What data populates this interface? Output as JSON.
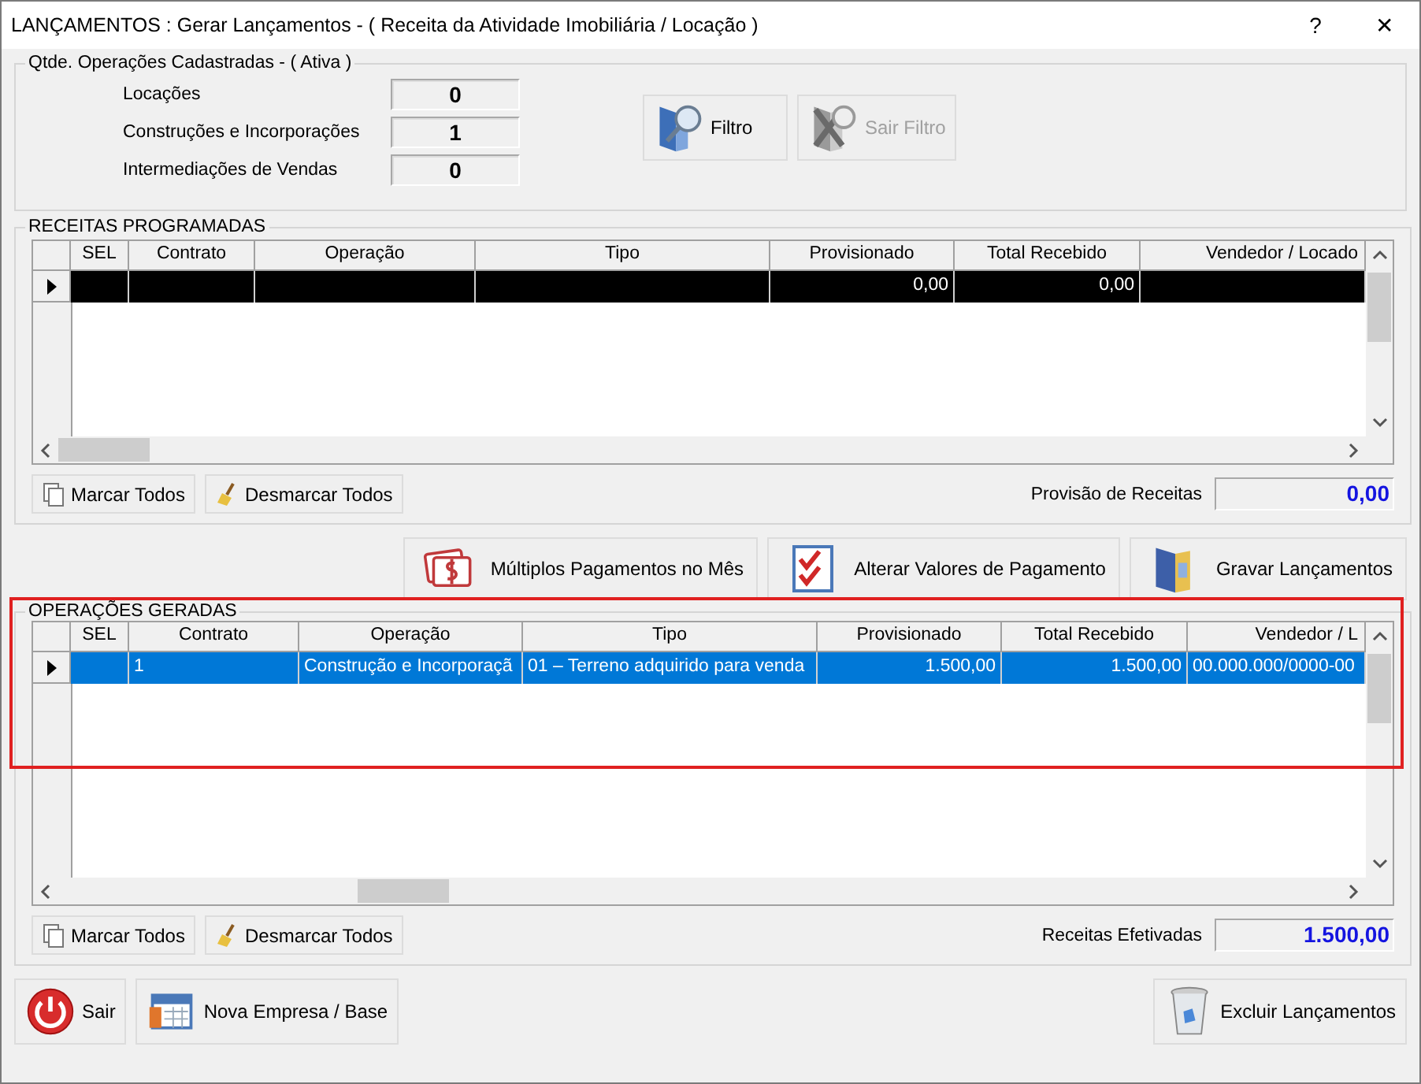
{
  "window": {
    "title": "LANÇAMENTOS : Gerar Lançamentos - ( Receita da Atividade Imobiliária / Locação )",
    "controls": [
      "?",
      "✕"
    ]
  },
  "counts": {
    "title": "Qtde. Operações Cadastradas - ( Ativa )",
    "items": [
      {
        "label": "Locações",
        "value": "0"
      },
      {
        "label": "Construções e Incorporações",
        "value": "1"
      },
      {
        "label": "Intermediações de Vendas",
        "value": "0"
      }
    ]
  },
  "filter_buttons": [
    {
      "label": "Filtro",
      "kind": "filter",
      "disabled": false
    },
    {
      "label": "Sair Filtro",
      "kind": "clear",
      "disabled": true
    }
  ],
  "receitas": {
    "title": "RECEITAS PROGRAMADAS",
    "focused": false,
    "columns": [
      "SEL",
      "Contrato",
      "Operação",
      "Tipo",
      "Provisionado",
      "Total Recebido",
      "Vendedor / Locado"
    ],
    "rows": [
      {
        "selected": true,
        "cells": [
          null,
          null,
          null,
          null,
          "0,00",
          "0,00",
          null
        ]
      }
    ],
    "buttons": [
      {
        "label": "Marcar Todos",
        "kind": "check"
      },
      {
        "label": "Desmarcar Todos",
        "kind": "broom"
      }
    ],
    "total": {
      "label": "Provisão de Receitas",
      "value": "0,00"
    }
  },
  "actions": [
    {
      "label": "Múltiplos Pagamentos no Mês",
      "kind": "money"
    },
    {
      "label": "Alterar Valores de Pagamento",
      "kind": "checklist"
    },
    {
      "label": "Gravar Lançamentos",
      "kind": "save"
    }
  ],
  "operacoes": {
    "title": "OPERAÇÕES GERADAS",
    "focused": true,
    "columns": [
      "SEL",
      "Contrato",
      "Operação",
      "Tipo",
      "Provisionado",
      "Total Recebido",
      "Vendedor / L"
    ],
    "rows": [
      {
        "selected": true,
        "cells": [
          null,
          "1",
          "Construção e Incorporaçã",
          "01 – Terreno adquirido para venda",
          "1.500,00",
          "1.500,00",
          "00.000.000/0000-00"
        ]
      }
    ],
    "buttons": [
      {
        "label": "Marcar Todos",
        "kind": "check"
      },
      {
        "label": "Desmarcar Todos",
        "kind": "broom"
      }
    ],
    "total": {
      "label": "Receitas Efetivadas",
      "value": "1.500,00"
    }
  },
  "footer_buttons": [
    {
      "label": "Sair",
      "kind": "exit"
    },
    {
      "label": "Nova Empresa / Base",
      "kind": "calendar"
    },
    {
      "label": "Excluir Lançamentos",
      "kind": "trash"
    }
  ]
}
